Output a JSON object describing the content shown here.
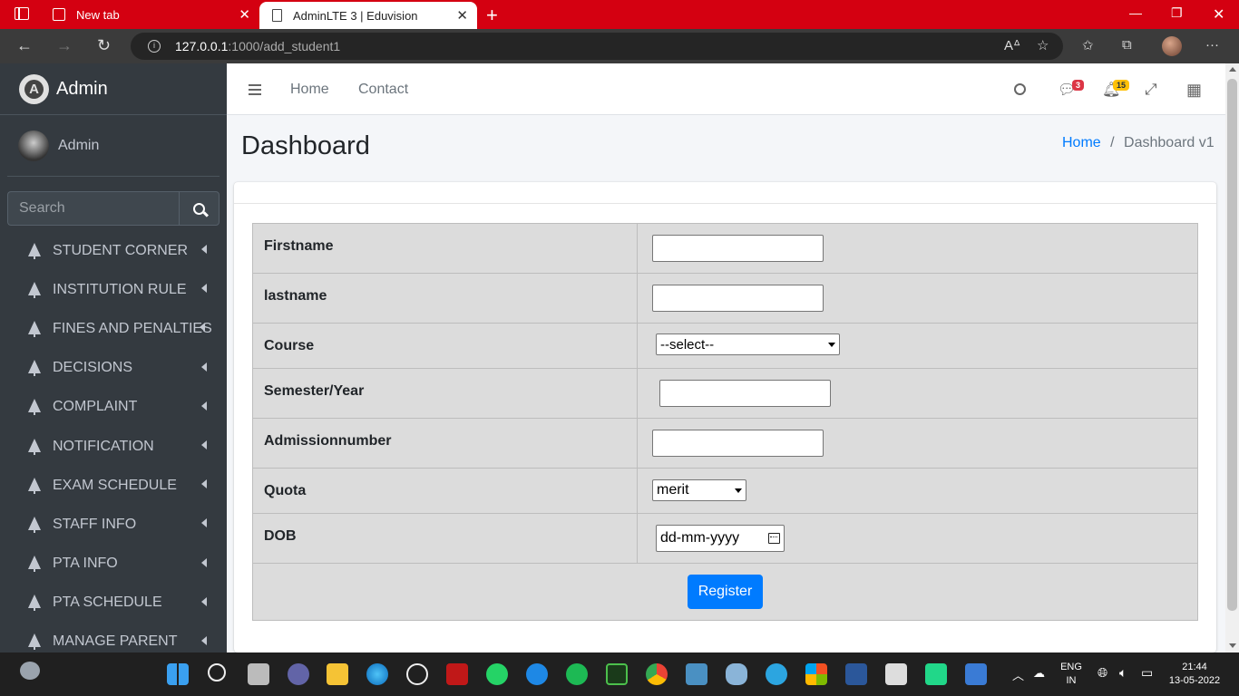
{
  "browser": {
    "tabs": [
      {
        "label": "New tab",
        "active": false
      },
      {
        "label": "AdminLTE 3 | Eduvision",
        "active": true
      }
    ],
    "url_host": "127.0.0.1",
    "url_path": ":1000/add_student1"
  },
  "sidebar": {
    "brand": "Admin",
    "user": "Admin",
    "search_placeholder": "Search",
    "items": [
      {
        "label": "STUDENT CORNER"
      },
      {
        "label": "INSTITUTION RULE"
      },
      {
        "label": "FINES AND PENALTIES"
      },
      {
        "label": "DECISIONS"
      },
      {
        "label": "COMPLAINT"
      },
      {
        "label": "NOTIFICATION"
      },
      {
        "label": "EXAM SCHEDULE"
      },
      {
        "label": "STAFF INFO"
      },
      {
        "label": "PTA INFO"
      },
      {
        "label": "PTA SCHEDULE"
      },
      {
        "label": "MANAGE PARENT"
      }
    ]
  },
  "topnav": {
    "home": "Home",
    "contact": "Contact",
    "messages_count": "3",
    "notifications_count": "15"
  },
  "page": {
    "title": "Dashboard",
    "breadcrumb_home": "Home",
    "breadcrumb_sep": "/",
    "breadcrumb_current": "Dashboard v1"
  },
  "form": {
    "firstname_label": "Firstname",
    "firstname_value": "",
    "lastname_label": "lastname",
    "lastname_value": "",
    "course_label": "Course",
    "course_selected": "--select--",
    "semester_label": "Semester/Year",
    "semester_value": "",
    "admission_label": "Admissionnumber",
    "admission_value": "",
    "quota_label": "Quota",
    "quota_selected": "merit",
    "dob_label": "DOB",
    "dob_placeholder": "dd-mm-yyyy",
    "register_label": "Register"
  },
  "taskbar": {
    "lang": "ENG",
    "region": "IN",
    "time": "21:44",
    "date": "13-05-2022"
  },
  "colors": {
    "browser_accent": "#d40011",
    "sidebar_bg": "#343a40",
    "primary": "#007bff",
    "badge_red": "#dc3545",
    "badge_yellow": "#ffc107"
  }
}
